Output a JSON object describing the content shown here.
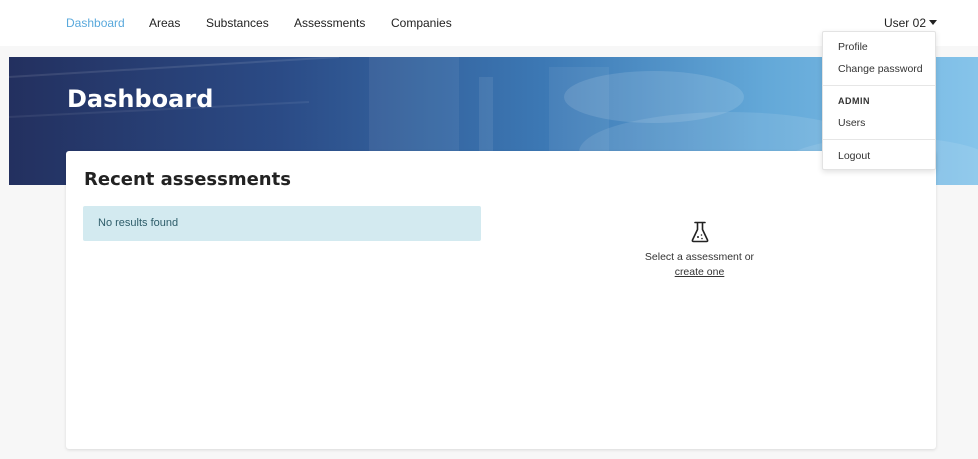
{
  "nav": {
    "items": [
      {
        "label": "Dashboard",
        "active": true
      },
      {
        "label": "Areas",
        "active": false
      },
      {
        "label": "Substances",
        "active": false
      },
      {
        "label": "Assessments",
        "active": false
      },
      {
        "label": "Companies",
        "active": false
      }
    ],
    "user_label": "User 02",
    "active_color": "#5aa9dc"
  },
  "hero": {
    "title": "Dashboard"
  },
  "card": {
    "title": "Recent assessments",
    "empty_message": "No results found",
    "empty_state": {
      "icon": "flask-icon",
      "text": "Select a assessment or",
      "link": "create one"
    }
  },
  "dropdown": {
    "profile": "Profile",
    "change_password": "Change password",
    "admin_header": "ADMIN",
    "users": "Users",
    "logout": "Logout"
  }
}
